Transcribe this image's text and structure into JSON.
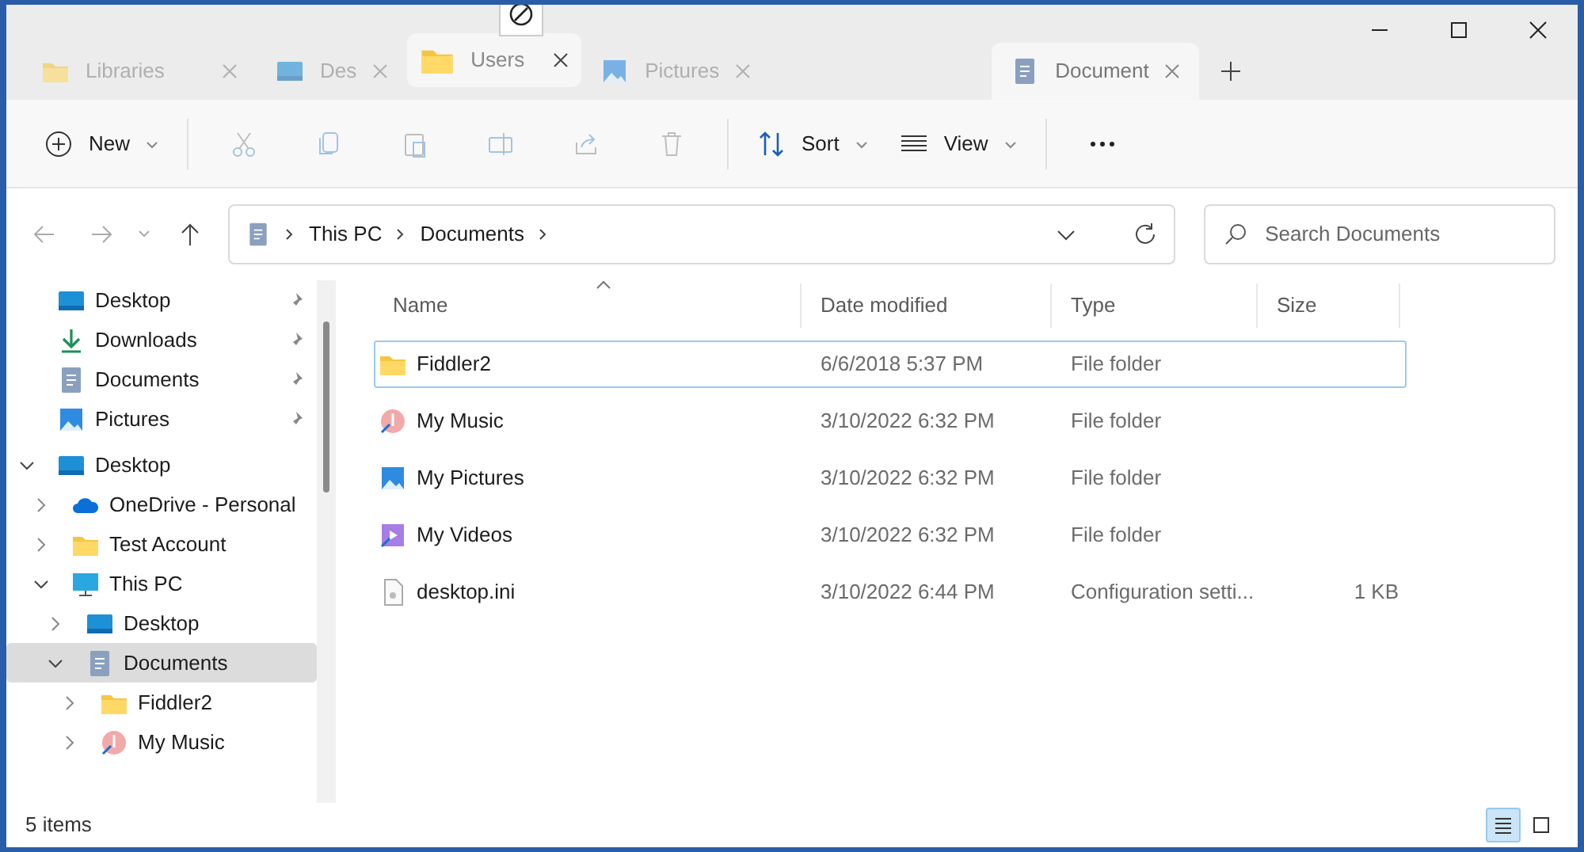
{
  "tabs": [
    {
      "label": "Libraries",
      "kind": "folder",
      "selected": false
    },
    {
      "label": "Des",
      "kind": "desktop",
      "selected": false
    },
    {
      "label": "Users",
      "kind": "folder",
      "selected": false,
      "dragged": true
    },
    {
      "label": "Pictures",
      "kind": "pictures",
      "selected": false
    },
    {
      "label": "Document",
      "kind": "document",
      "selected": true
    }
  ],
  "toolbar": [
    {
      "kind": "new",
      "label": "New"
    },
    {
      "kind": "separator"
    },
    {
      "kind": "cut"
    },
    {
      "kind": "copy"
    },
    {
      "kind": "paste"
    },
    {
      "kind": "rename"
    },
    {
      "kind": "share"
    },
    {
      "kind": "delete"
    },
    {
      "kind": "separator"
    },
    {
      "kind": "sort",
      "label": "Sort"
    },
    {
      "kind": "view",
      "label": "View"
    },
    {
      "kind": "separator"
    },
    {
      "kind": "more"
    }
  ],
  "address": {
    "crumbs": [
      "This PC",
      "Documents"
    ]
  },
  "search": {
    "placeholder": "Search Documents"
  },
  "quick_access": [
    {
      "label": "Desktop",
      "kind": "desktop"
    },
    {
      "label": "Downloads",
      "kind": "download"
    },
    {
      "label": "Documents",
      "kind": "document"
    },
    {
      "label": "Pictures",
      "kind": "pictures"
    }
  ],
  "tree": [
    {
      "label": "Desktop",
      "kind": "desktop",
      "expanded": true,
      "selected": false,
      "children": [
        {
          "label": "OneDrive - Personal",
          "kind": "cloud",
          "expanded": false,
          "selected": false
        },
        {
          "label": "Test Account",
          "kind": "folder",
          "expanded": false,
          "selected": false
        },
        {
          "label": "This PC",
          "kind": "pc",
          "expanded": true,
          "selected": false,
          "children": [
            {
              "label": "Desktop",
              "kind": "desktop",
              "expanded": false,
              "selected": false
            },
            {
              "label": "Documents",
              "kind": "document",
              "expanded": true,
              "selected": true,
              "children": [
                {
                  "label": "Fiddler2",
                  "kind": "folder",
                  "expanded": false,
                  "selected": false
                },
                {
                  "label": "My Music",
                  "kind": "music",
                  "expanded": false,
                  "selected": false
                }
              ]
            }
          ]
        }
      ]
    }
  ],
  "table": {
    "columns": [
      "Name",
      "Date modified",
      "Type",
      "Size"
    ],
    "rows": [
      {
        "kind": "folder",
        "name": "Fiddler2",
        "date": "6/6/2018 5:37 PM",
        "type": "File folder",
        "selected": true
      },
      {
        "kind": "music",
        "name": "My Music",
        "date": "3/10/2022 6:32 PM",
        "type": "File folder",
        "selected": false
      },
      {
        "kind": "pictures",
        "name": "My Pictures",
        "date": "3/10/2022 6:32 PM",
        "type": "File folder",
        "selected": false
      },
      {
        "kind": "videos",
        "name": "My Videos",
        "date": "3/10/2022 6:32 PM",
        "type": "File folder",
        "selected": false
      },
      {
        "kind": "file",
        "name": "desktop.ini",
        "date": "3/10/2022 6:44 PM",
        "type": "Configuration setti...",
        "size": "1 KB",
        "selected": false
      }
    ]
  },
  "status_bar": {
    "count": "5 items",
    "views": [
      {
        "kind": "details",
        "selected": true
      },
      {
        "kind": "tiles",
        "selected": false
      }
    ]
  }
}
